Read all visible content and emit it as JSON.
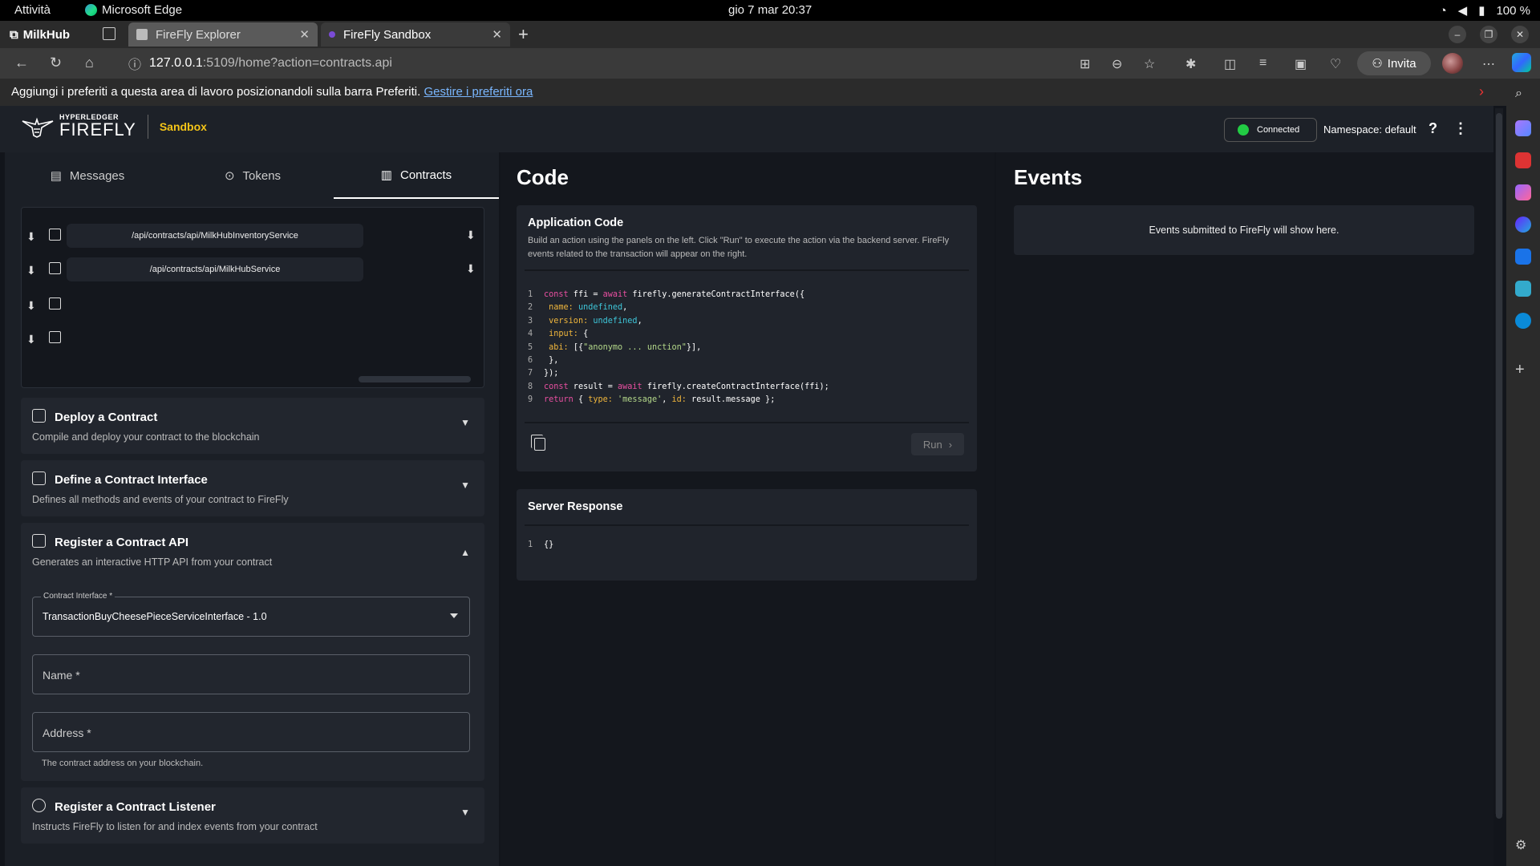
{
  "os": {
    "activities": "Attività",
    "app_name": "Microsoft Edge",
    "clock": "gio 7 mar  20:37",
    "battery": "100 %"
  },
  "browser": {
    "profile": "MilkHub",
    "tabs": [
      {
        "title": "FireFly Explorer"
      },
      {
        "title": "FireFly Sandbox"
      }
    ],
    "url_host": "127.0.0.1",
    "url_path": ":5109/home?action=contracts.api",
    "invite_label": "Invita",
    "favorites_text": "Aggiungi i preferiti a questa area di lavoro posizionandoli sulla barra Preferiti.",
    "favorites_link": "Gestire i preferiti ora"
  },
  "header": {
    "logo_small": "HYPERLEDGER",
    "logo_big": "FIREFLY",
    "sandbox": "Sandbox",
    "status": "Connected",
    "namespace": "Namespace: default",
    "help": "?",
    "more": "⋮"
  },
  "left": {
    "tabs": [
      {
        "label": "Messages",
        "icon": "message-icon"
      },
      {
        "label": "Tokens",
        "icon": "token-icon"
      },
      {
        "label": "Contracts",
        "icon": "document-icon"
      }
    ],
    "apis": [
      "/api/contracts/api/MilkHubInventoryService",
      "/api/contracts/api/MilkHubService",
      "",
      ""
    ],
    "sections": {
      "deploy": {
        "title": "Deploy a Contract",
        "desc": "Compile and deploy your contract to the blockchain"
      },
      "define": {
        "title": "Define a Contract Interface",
        "desc": "Defines all methods and events of your contract to FireFly"
      },
      "register": {
        "title": "Register a Contract API",
        "desc": "Generates an interactive HTTP API from your contract"
      },
      "listener": {
        "title": "Register a Contract Listener",
        "desc": "Instructs FireFly to listen for and index events from your contract"
      }
    },
    "form": {
      "interface_label": "Contract Interface *",
      "interface_value": "TransactionBuyCheesePieceServiceInterface - 1.0",
      "name_placeholder": "Name *",
      "address_placeholder": "Address *",
      "address_helper": "The contract address on your blockchain."
    }
  },
  "middle": {
    "heading": "Code",
    "app_code_title": "Application Code",
    "app_code_desc": "Build an action using the panels on the left. Click \"Run\" to execute the action via the backend server. FireFly events related to the transaction will appear on the right.",
    "run_label": "Run",
    "server_title": "Server Response",
    "server_line_no": "1",
    "server_body": "{}"
  },
  "right": {
    "heading": "Events",
    "empty_text": "Events submitted to FireFly will show here."
  }
}
